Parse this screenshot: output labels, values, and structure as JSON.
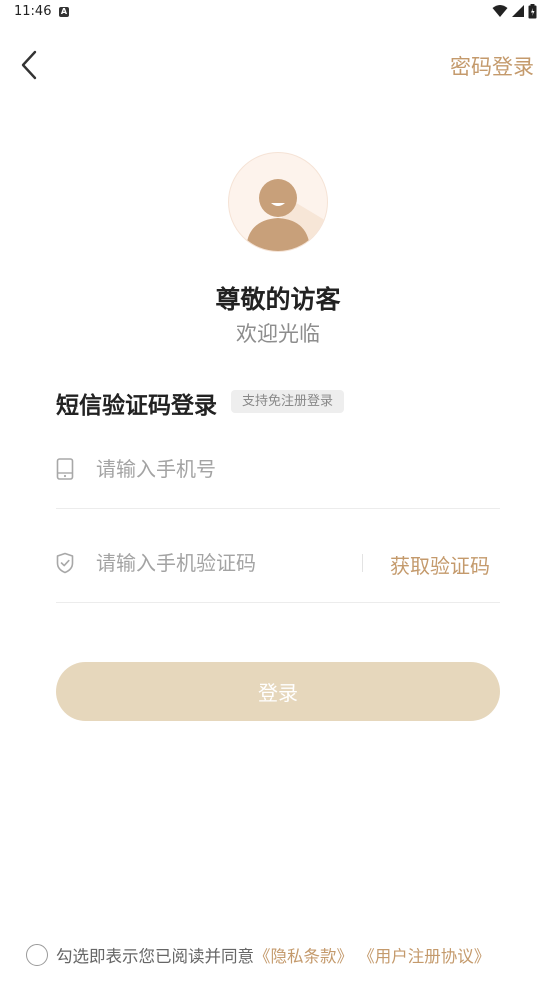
{
  "status_bar": {
    "time": "11:46",
    "left_icon": "A",
    "icons": [
      "wifi-icon",
      "signal-icon",
      "battery-icon"
    ]
  },
  "header": {
    "back_icon": "chevron-left-icon",
    "password_login_label": "密码登录"
  },
  "profile": {
    "avatar_icon": "default-user-avatar-icon",
    "title": "尊敬的访客",
    "subtitle": "欢迎光临"
  },
  "login_section": {
    "title": "短信验证码登录",
    "tag": "支持免注册登录"
  },
  "form": {
    "phone_icon": "phone-icon",
    "phone_placeholder": "请输入手机号",
    "phone_value": "",
    "code_icon": "shield-check-icon",
    "code_placeholder": "请输入手机验证码",
    "code_value": "",
    "get_code_label": "获取验证码"
  },
  "login_button_label": "登录",
  "agreement": {
    "prefix": "勾选即表示您已阅读并同意",
    "privacy_link": "《隐私条款》",
    "separator": " ",
    "user_agreement_link": "《用户注册协议》"
  },
  "colors": {
    "accent": "#c49a6c",
    "login_button_bg": "#e6d7bc",
    "avatar_fill": "#c8a07a",
    "avatar_bg": "#fbeee4"
  }
}
